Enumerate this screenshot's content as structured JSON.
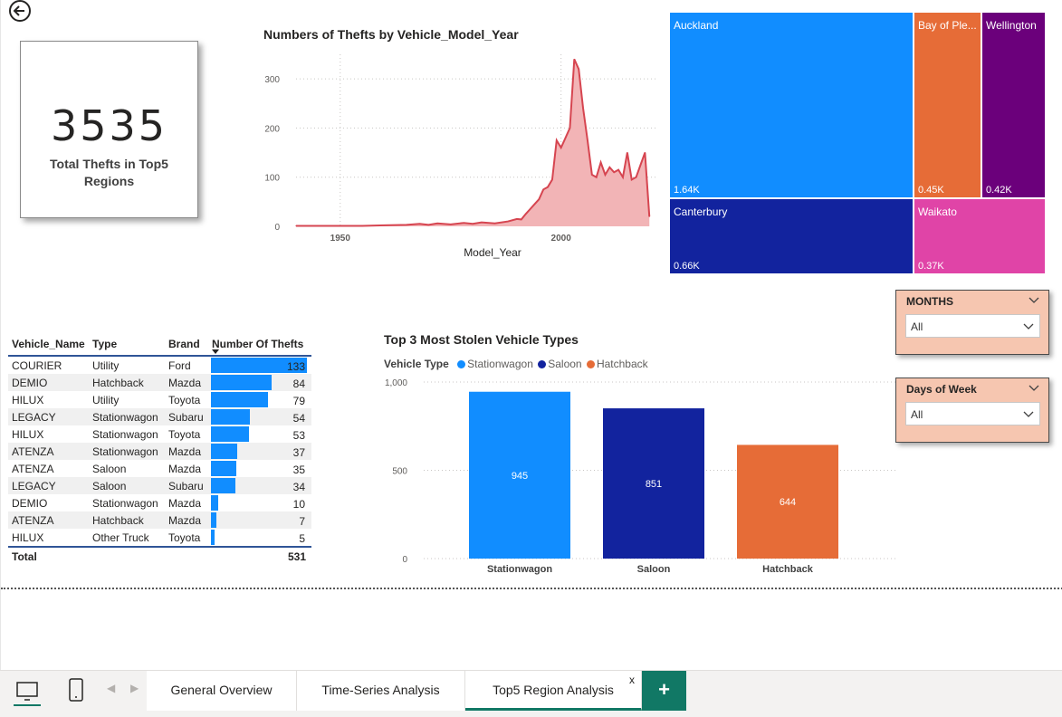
{
  "kpi": {
    "value": "3535",
    "label": "Total Thefts in Top5 Regions"
  },
  "line_chart_title": "Numbers of Thefts by Vehicle_Model_Year",
  "line_chart_xlabel": "Model_Year",
  "line_chart_yticks": [
    "0",
    "100",
    "200",
    "300"
  ],
  "line_chart_xticks": [
    "1950",
    "2000"
  ],
  "treemap": [
    {
      "name": "Auckland",
      "value": "1.64K",
      "color": "#118dff"
    },
    {
      "name": "Bay of Ple...",
      "value": "0.45K",
      "color": "#e66c37"
    },
    {
      "name": "Wellington",
      "value": "0.42K",
      "color": "#6b007b"
    },
    {
      "name": "Canterbury",
      "value": "0.66K",
      "color": "#12239e"
    },
    {
      "name": "Waikato",
      "value": "0.37K",
      "color": "#e044a7"
    }
  ],
  "slicers": {
    "months": {
      "title": "MONTHS",
      "value": "All"
    },
    "days": {
      "title": "Days of Week",
      "value": "All"
    }
  },
  "table": {
    "headers": [
      "Vehicle_Name",
      "Type",
      "Brand",
      "Number Of Thefts"
    ],
    "rows": [
      {
        "name": "COURIER",
        "type": "Utility",
        "brand": "Ford",
        "count": 133
      },
      {
        "name": "DEMIO",
        "type": "Hatchback",
        "brand": "Mazda",
        "count": 84
      },
      {
        "name": "HILUX",
        "type": "Utility",
        "brand": "Toyota",
        "count": 79
      },
      {
        "name": "LEGACY",
        "type": "Stationwagon",
        "brand": "Subaru",
        "count": 54
      },
      {
        "name": "HILUX",
        "type": "Stationwagon",
        "brand": "Toyota",
        "count": 53
      },
      {
        "name": "ATENZA",
        "type": "Stationwagon",
        "brand": "Mazda",
        "count": 37
      },
      {
        "name": "ATENZA",
        "type": "Saloon",
        "brand": "Mazda",
        "count": 35
      },
      {
        "name": "LEGACY",
        "type": "Saloon",
        "brand": "Subaru",
        "count": 34
      },
      {
        "name": "DEMIO",
        "type": "Stationwagon",
        "brand": "Mazda",
        "count": 10
      },
      {
        "name": "ATENZA",
        "type": "Hatchback",
        "brand": "Mazda",
        "count": 7
      },
      {
        "name": "HILUX",
        "type": "Other Truck",
        "brand": "Toyota",
        "count": 5
      }
    ],
    "total_label": "Total",
    "total_value": "531"
  },
  "bar_chart_title": "Top 3 Most Stolen Vehicle Types",
  "bar_legend": {
    "title": "Vehicle Type",
    "items": [
      {
        "label": "Stationwagon",
        "color": "#118dff"
      },
      {
        "label": "Saloon",
        "color": "#12239e"
      },
      {
        "label": "Hatchback",
        "color": "#e66c37"
      }
    ]
  },
  "chart_data": [
    {
      "type": "area",
      "title": "Numbers of Thefts by Vehicle_Model_Year",
      "xlabel": "Model_Year",
      "ylabel": "",
      "xlim": [
        1940,
        2022
      ],
      "ylim": [
        0,
        350
      ],
      "color": "#d64550",
      "x": [
        1940,
        1945,
        1950,
        1955,
        1960,
        1965,
        1968,
        1970,
        1972,
        1975,
        1978,
        1980,
        1982,
        1985,
        1988,
        1990,
        1991,
        1992,
        1993,
        1994,
        1995,
        1996,
        1997,
        1998,
        1999,
        2000,
        2001,
        2002,
        2003,
        2004,
        2005,
        2006,
        2007,
        2008,
        2009,
        2010,
        2011,
        2012,
        2013,
        2014,
        2015,
        2016,
        2017,
        2018,
        2019,
        2020
      ],
      "y": [
        1,
        1,
        1,
        1,
        2,
        3,
        5,
        3,
        6,
        4,
        7,
        5,
        8,
        6,
        10,
        15,
        14,
        25,
        35,
        45,
        55,
        75,
        80,
        95,
        175,
        160,
        180,
        200,
        340,
        320,
        240,
        175,
        105,
        100,
        130,
        105,
        120,
        110,
        115,
        100,
        150,
        95,
        100,
        125,
        150,
        20
      ]
    },
    {
      "type": "bar",
      "title": "Top 3 Most Stolen Vehicle Types",
      "categories": [
        "Stationwagon",
        "Saloon",
        "Hatchback"
      ],
      "values": [
        945,
        851,
        644
      ],
      "labels": [
        "945",
        "851",
        "644"
      ],
      "colors": [
        "#118dff",
        "#12239e",
        "#e66c37"
      ],
      "ylim": [
        0,
        1000
      ],
      "yticks": [
        "0",
        "500",
        "1,000"
      ],
      "grid": true
    }
  ],
  "tabs": {
    "items": [
      "General Overview",
      "Time-Series Analysis",
      "Top5 Region Analysis"
    ],
    "close_label": "x",
    "add_label": "+"
  }
}
